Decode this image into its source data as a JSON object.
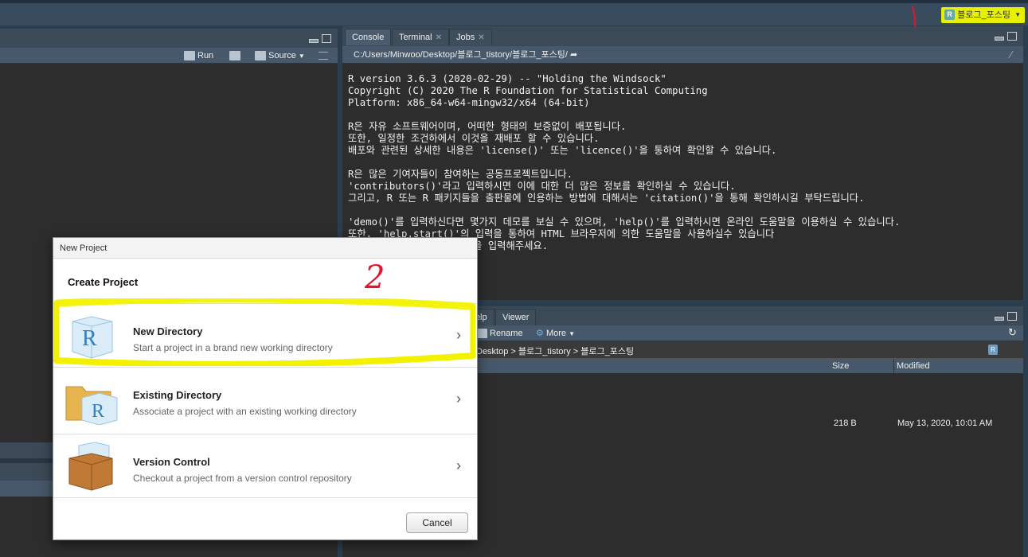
{
  "project_button": {
    "label": "블로그_포스팅"
  },
  "source_pane": {
    "run_label": "Run",
    "source_label": "Source"
  },
  "console_pane": {
    "tabs": [
      {
        "label": "Console"
      },
      {
        "label": "Terminal"
      },
      {
        "label": "Jobs"
      }
    ],
    "path": "C:/Users/Minwoo/Desktop/블로그_tistory/블로그_포스팅/",
    "lines": [
      "R version 3.6.3 (2020-02-29) -- \"Holding the Windsock\"",
      "Copyright (C) 2020 The R Foundation for Statistical Computing",
      "Platform: x86_64-w64-mingw32/x64 (64-bit)",
      "",
      "R은 자유 소프트웨어이며, 어떠한 형태의 보증없이 배포됩니다.",
      "또한, 일정한 조건하에서 이것을 재배포 할 수 있습니다.",
      "배포와 관련된 상세한 내용은 'license()' 또는 'licence()'을 통하여 확인할 수 있습니다.",
      "",
      "R은 많은 기여자들이 참여하는 공동프로젝트입니다.",
      "'contributors()'라고 입력하시면 이에 대한 더 많은 정보를 확인하실 수 있습니다.",
      "그리고, R 또는 R 패키지들을 출판물에 인용하는 방법에 대해서는 'citation()'을 통해 확인하시길 부탁드립니다.",
      "",
      "'demo()'를 입력하신다면 몇가지 데모를 보실 수 있으며, 'help()'를 입력하시면 온라인 도움말을 이용하실 수 있습니다.",
      "또한, 'help.start()'의 입력을 통하여 HTML 브라우저에 의한 도움말을 사용하실수 있습니다",
      "R의 종료를 원하시면 'q()'을 입력해주세요."
    ]
  },
  "files_pane": {
    "tabs": [
      {
        "label": "Help"
      },
      {
        "label": "Viewer"
      }
    ],
    "rename_label": "Rename",
    "more_label": "More",
    "breadcrumb": "Desktop  >  블로그_tistory  >  블로그_포스팅",
    "col_size": "Size",
    "col_modified": "Modified",
    "row_size": "218 B",
    "row_modified": "May 13, 2020, 10:01 AM"
  },
  "dialog": {
    "title": "New Project",
    "heading": "Create Project",
    "options": [
      {
        "title": "New Directory",
        "desc": "Start a project in a brand new working directory"
      },
      {
        "title": "Existing Directory",
        "desc": "Associate a project with an existing working directory"
      },
      {
        "title": "Version Control",
        "desc": "Checkout a project from a version control repository"
      }
    ],
    "cancel_label": "Cancel"
  },
  "annotations": {
    "mark1": "1",
    "mark2": "2"
  },
  "colors": {
    "highlight": "#f2f200",
    "annotation_red": "#e8132a",
    "project_button": "#e6f000"
  }
}
